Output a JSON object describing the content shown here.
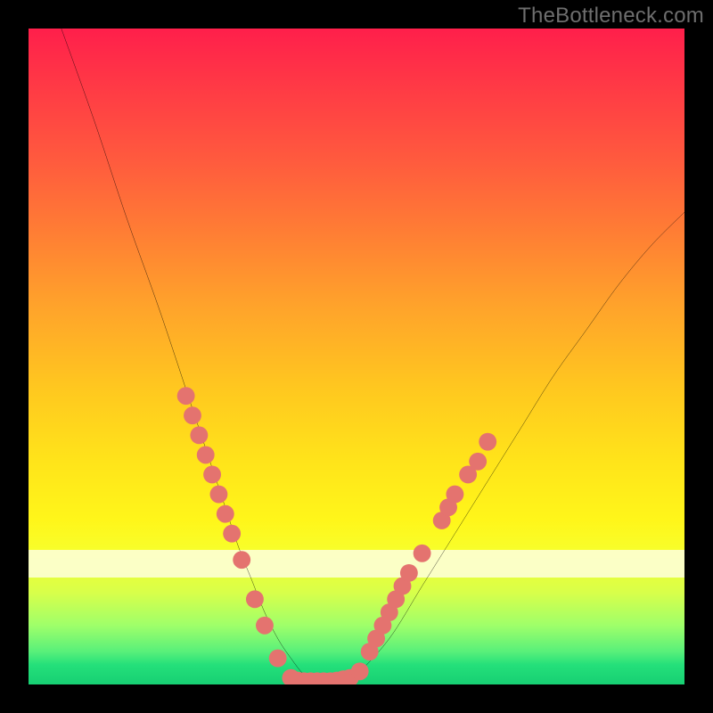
{
  "watermark": "TheBottleneck.com",
  "chart_data": {
    "type": "line",
    "title": "",
    "xlabel": "",
    "ylabel": "",
    "xlim": [
      0,
      100
    ],
    "ylim": [
      0,
      100
    ],
    "grid": false,
    "legend": false,
    "annotations": [
      {
        "text": "TheBottleneck.com",
        "position": "top-right"
      }
    ],
    "series": [
      {
        "name": "bottleneck-curve",
        "x": [
          5,
          10,
          15,
          20,
          25,
          28,
          30,
          32,
          34,
          36,
          38,
          40,
          42,
          44,
          46,
          48,
          50,
          55,
          60,
          65,
          70,
          75,
          80,
          85,
          90,
          95,
          100
        ],
        "y": [
          100,
          86,
          71,
          57,
          42,
          33,
          27,
          21,
          16,
          11,
          7,
          4,
          1.5,
          0.5,
          0.5,
          0.5,
          1.5,
          7,
          15,
          23,
          31,
          39,
          47,
          54,
          61,
          67,
          72
        ]
      }
    ],
    "markers": [
      {
        "name": "left-cluster",
        "color": "#e4736f",
        "points": [
          {
            "x": 24.0,
            "y": 44
          },
          {
            "x": 25.0,
            "y": 41
          },
          {
            "x": 26.0,
            "y": 38
          },
          {
            "x": 27.0,
            "y": 35
          },
          {
            "x": 28.0,
            "y": 32
          },
          {
            "x": 29.0,
            "y": 29
          },
          {
            "x": 30.0,
            "y": 26
          },
          {
            "x": 31.0,
            "y": 23
          },
          {
            "x": 32.5,
            "y": 19
          },
          {
            "x": 34.5,
            "y": 13
          },
          {
            "x": 36.0,
            "y": 9
          },
          {
            "x": 38.0,
            "y": 4
          }
        ]
      },
      {
        "name": "valley-floor",
        "color": "#e4736f",
        "points": [
          {
            "x": 40,
            "y": 1.0
          },
          {
            "x": 41,
            "y": 0.6
          },
          {
            "x": 42,
            "y": 0.5
          },
          {
            "x": 43,
            "y": 0.5
          },
          {
            "x": 44,
            "y": 0.5
          },
          {
            "x": 45,
            "y": 0.5
          },
          {
            "x": 46,
            "y": 0.5
          },
          {
            "x": 47,
            "y": 0.6
          },
          {
            "x": 48,
            "y": 0.8
          },
          {
            "x": 49,
            "y": 1.0
          }
        ]
      },
      {
        "name": "right-cluster",
        "color": "#e4736f",
        "points": [
          {
            "x": 50.5,
            "y": 2
          },
          {
            "x": 52.0,
            "y": 5
          },
          {
            "x": 53.0,
            "y": 7
          },
          {
            "x": 54.0,
            "y": 9
          },
          {
            "x": 55.0,
            "y": 11
          },
          {
            "x": 56.0,
            "y": 13
          },
          {
            "x": 57.0,
            "y": 15
          },
          {
            "x": 58.0,
            "y": 17
          },
          {
            "x": 60.0,
            "y": 20
          },
          {
            "x": 63.0,
            "y": 25
          },
          {
            "x": 64.0,
            "y": 27
          },
          {
            "x": 65.0,
            "y": 29
          },
          {
            "x": 67.0,
            "y": 32
          },
          {
            "x": 68.5,
            "y": 34
          },
          {
            "x": 70.0,
            "y": 37
          }
        ]
      }
    ]
  }
}
